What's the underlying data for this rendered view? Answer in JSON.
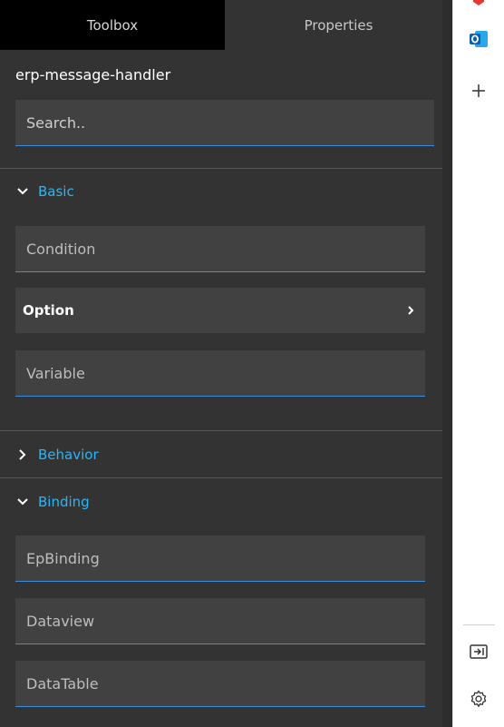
{
  "tabs": {
    "toolbox": "Toolbox",
    "properties": "Properties"
  },
  "component_name": "erp-message-handler",
  "search": {
    "placeholder": "Search.."
  },
  "sections": {
    "basic": {
      "label": "Basic",
      "fields": {
        "condition": "Condition",
        "option": "Option",
        "variable": "Variable"
      }
    },
    "behavior": {
      "label": "Behavior"
    },
    "binding": {
      "label": "Binding",
      "fields": {
        "ep_binding": "EpBinding",
        "dataview": "Dataview",
        "datatable": "DataTable"
      }
    }
  },
  "sidebar": {
    "icons": [
      "app-icon-red",
      "outlook-icon",
      "add-icon",
      "exit-panel-icon",
      "gear-icon"
    ]
  },
  "colors": {
    "accent": "#29b6f6",
    "underline": "#3d8fd9",
    "panel_bg": "#333333",
    "field_bg": "#414141",
    "active_tab_bg": "#000000"
  }
}
